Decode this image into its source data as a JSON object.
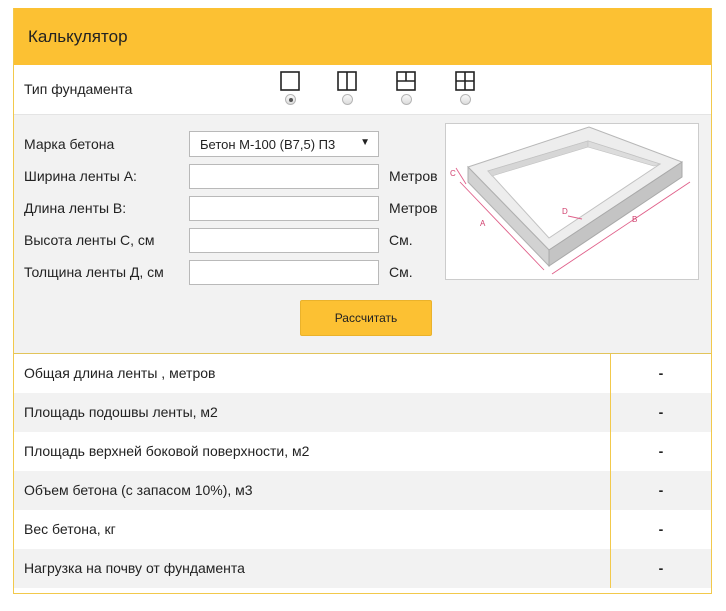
{
  "header": {
    "title": "Калькулятор"
  },
  "foundation_type": {
    "label": "Тип фундамента",
    "selected_index": 0,
    "options": [
      "square-icon",
      "square-one-divider-icon",
      "square-t-divider-icon",
      "square-cross-icon"
    ]
  },
  "form": {
    "concrete_grade": {
      "label": "Марка бетона",
      "value": "Бетон М-100 (В7,5) П3"
    },
    "width_a": {
      "label": "Ширина ленты А:",
      "value": "",
      "unit": "Метров"
    },
    "length_b": {
      "label": "Длина ленты В:",
      "value": "",
      "unit": "Метров"
    },
    "height_c": {
      "label": "Высота ленты С, см",
      "value": "",
      "unit": "См."
    },
    "thickness_d": {
      "label": "Толщина ленты Д, см",
      "value": "",
      "unit": "См."
    },
    "calculate_label": "Рассчитать"
  },
  "diagram": {
    "labels": [
      "C",
      "A",
      "D",
      "B"
    ]
  },
  "results": [
    {
      "label": "Общая длина ленты , метров",
      "value": "-"
    },
    {
      "label": "Площадь подошвы ленты, м2",
      "value": "-"
    },
    {
      "label": "Площадь верхней боковой поверхности, м2",
      "value": "-"
    },
    {
      "label": "Объем бетона (с запасом 10%), м3",
      "value": "-"
    },
    {
      "label": "Вес бетона, кг",
      "value": "-"
    },
    {
      "label": "Нагрузка на почву от фундамента",
      "value": "-"
    }
  ],
  "colors": {
    "accent": "#fcc133",
    "border": "#f2c94c",
    "panel": "#f2f2f2"
  }
}
